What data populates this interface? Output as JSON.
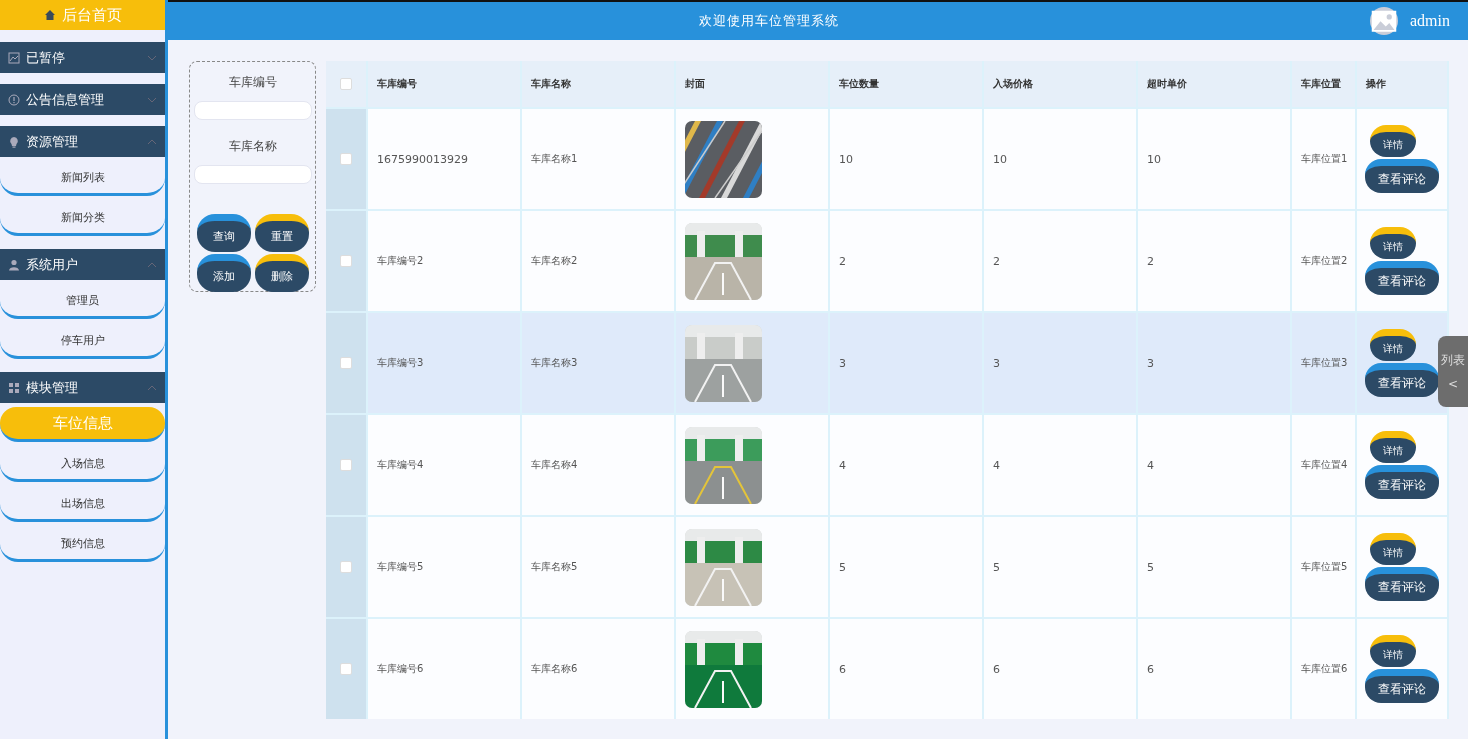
{
  "sidebar": {
    "home": "后台首页",
    "groups": [
      {
        "label": "已暂停",
        "expanded": false
      },
      {
        "label": "公告信息管理",
        "expanded": false
      },
      {
        "label": "资源管理",
        "expanded": true,
        "items": [
          {
            "label": "新闻列表",
            "selected": false
          },
          {
            "label": "新闻分类",
            "selected": false
          }
        ]
      },
      {
        "label": "系统用户",
        "expanded": true,
        "items": [
          {
            "label": "管理员",
            "selected": false
          },
          {
            "label": "停车用户",
            "selected": false
          }
        ]
      },
      {
        "label": "模块管理",
        "expanded": true,
        "items": [
          {
            "label": "车位信息",
            "selected": true
          },
          {
            "label": "入场信息",
            "selected": false
          },
          {
            "label": "出场信息",
            "selected": false
          },
          {
            "label": "预约信息",
            "selected": false
          }
        ]
      }
    ]
  },
  "header": {
    "title": "欢迎使用车位管理系统",
    "user": "admin"
  },
  "search": {
    "fields": [
      {
        "label": "车库编号"
      },
      {
        "label": "车库名称"
      }
    ],
    "buttons": [
      {
        "label": "查询",
        "kind": "blue"
      },
      {
        "label": "重置",
        "kind": "yellow"
      },
      {
        "label": "添加",
        "kind": "blue"
      },
      {
        "label": "删除",
        "kind": "yellow"
      }
    ]
  },
  "table": {
    "columns": [
      "车库编号",
      "车库名称",
      "封面",
      "车位数量",
      "入场价格",
      "超时单价",
      "车库位置",
      "操作"
    ],
    "all_checked": false,
    "rows": [
      {
        "checked": false,
        "hovered": false,
        "code": "1675990013929",
        "name": "车库名称1",
        "spaces": "10",
        "price": "10",
        "overtime": "10",
        "location": "车库位置1",
        "actions": [
          "详情",
          "查看评论"
        ]
      },
      {
        "checked": false,
        "hovered": false,
        "code": "车库编号2",
        "name": "车库名称2",
        "spaces": "2",
        "price": "2",
        "overtime": "2",
        "location": "车库位置2",
        "actions": [
          "详情",
          "查看评论"
        ]
      },
      {
        "checked": false,
        "hovered": true,
        "code": "车库编号3",
        "name": "车库名称3",
        "spaces": "3",
        "price": "3",
        "overtime": "3",
        "location": "车库位置3",
        "actions": [
          "详情",
          "查看评论"
        ]
      },
      {
        "checked": false,
        "hovered": false,
        "code": "车库编号4",
        "name": "车库名称4",
        "spaces": "4",
        "price": "4",
        "overtime": "4",
        "location": "车库位置4",
        "actions": [
          "详情",
          "查看评论"
        ]
      },
      {
        "checked": false,
        "hovered": false,
        "code": "车库编号5",
        "name": "车库名称5",
        "spaces": "5",
        "price": "5",
        "overtime": "5",
        "location": "车库位置5",
        "actions": [
          "详情",
          "查看评论"
        ]
      },
      {
        "checked": false,
        "hovered": false,
        "code": "车库编号6",
        "name": "车库名称6",
        "spaces": "6",
        "price": "6",
        "overtime": "6",
        "location": "车库位置6",
        "actions": [
          "详情",
          "查看评论"
        ]
      }
    ]
  },
  "side_tab": {
    "label": "列表",
    "arrow": "<"
  }
}
